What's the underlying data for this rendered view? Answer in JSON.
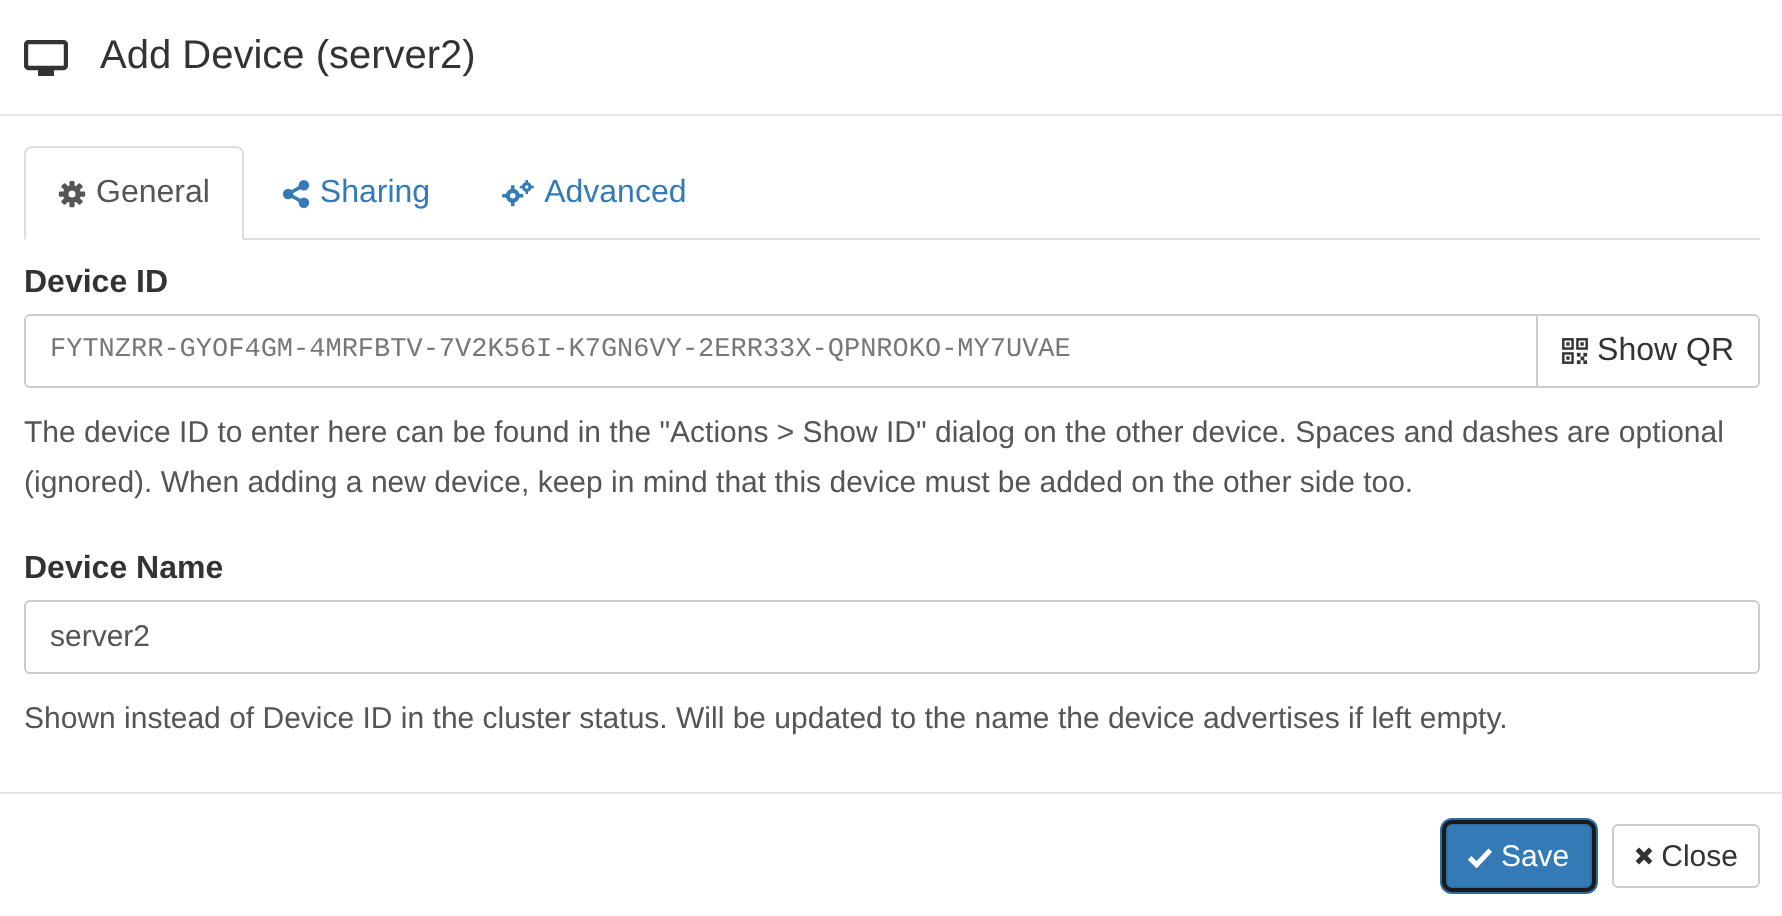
{
  "window": {
    "title": "Add Device (server2)"
  },
  "tabs": [
    {
      "label": "General",
      "kind": "gear",
      "selected": true
    },
    {
      "label": "Sharing",
      "kind": "share",
      "selected": false
    },
    {
      "label": "Advanced",
      "kind": "gears",
      "selected": false
    }
  ],
  "device_id": {
    "label": "Device ID",
    "value": "FYTNZRR-GYOF4GM-4MRFBTV-7V2K56I-K7GN6VY-2ERR33X-QPNROKO-MY7UVAE",
    "button": "Show QR",
    "help": "The device ID to enter here can be found in the \"Actions > Show ID\" dialog on the other device. Spaces and dashes are optional (ignored). When adding a new device, keep in mind that this device must be added on the other side too."
  },
  "device_name": {
    "label": "Device Name",
    "value": "server2",
    "help": "Shown instead of Device ID in the cluster status. Will be updated to the name the device advertises if left empty."
  },
  "buttons": [
    {
      "label": "Save",
      "kind": "primary",
      "focused": true
    },
    {
      "label": "Close",
      "kind": "default",
      "focused": false
    }
  ]
}
